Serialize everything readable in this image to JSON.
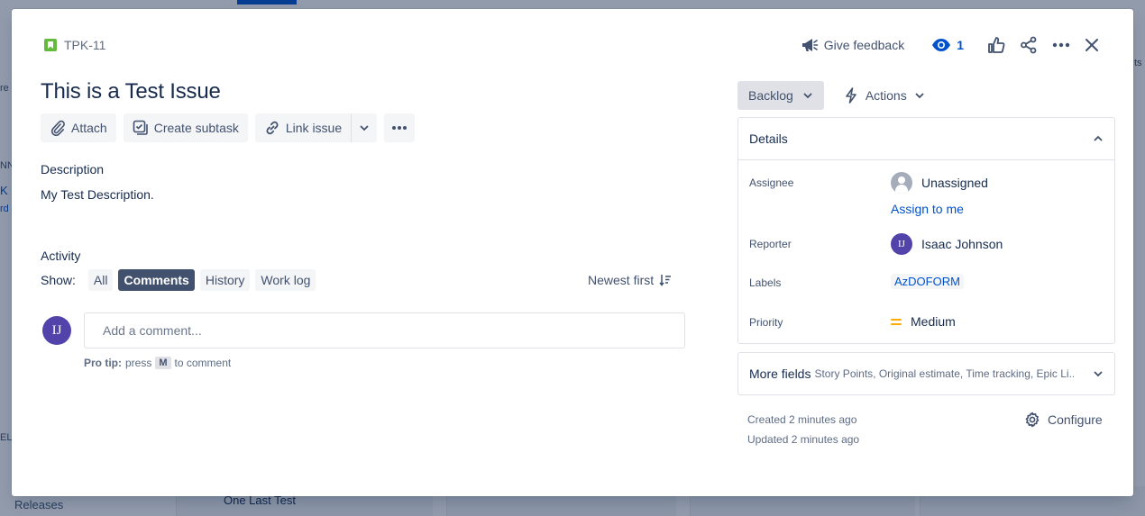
{
  "background": {
    "side_labels": [
      "re",
      "NN",
      "K I",
      "rd",
      "EL"
    ],
    "releases": "Releases",
    "card": "One Last Test",
    "right_edge": "ts"
  },
  "issue": {
    "key": "TPK-11",
    "title": "This is a Test Issue"
  },
  "toolbar": {
    "feedback": "Give feedback",
    "watch_count": "1"
  },
  "actions": {
    "attach": "Attach",
    "create_subtask": "Create subtask",
    "link_issue": "Link issue"
  },
  "description": {
    "label": "Description",
    "text": "My Test Description."
  },
  "activity": {
    "label": "Activity",
    "show_label": "Show:",
    "filters": [
      "All",
      "Comments",
      "History",
      "Work log"
    ],
    "active_filter": "Comments",
    "sort": "Newest first",
    "comment_avatar": "IJ",
    "comment_placeholder": "Add a comment...",
    "protip_bold": "Pro tip:",
    "protip_press": "press",
    "protip_key": "M",
    "protip_rest": "to comment"
  },
  "status": {
    "value": "Backlog",
    "actions": "Actions"
  },
  "details": {
    "title": "Details",
    "assignee_label": "Assignee",
    "assignee_value": "Unassigned",
    "assign_to_me": "Assign to me",
    "reporter_label": "Reporter",
    "reporter_initials": "IJ",
    "reporter_value": "Isaac Johnson",
    "labels_label": "Labels",
    "labels_value": "AzDOFORM",
    "priority_label": "Priority",
    "priority_value": "Medium"
  },
  "more_fields": {
    "title": "More fields",
    "list": "Story Points, Original estimate, Time tracking, Epic Li..."
  },
  "meta": {
    "created": "Created 2 minutes ago",
    "updated": "Updated 2 minutes ago",
    "configure": "Configure"
  },
  "colors": {
    "primary": "#0052cc",
    "avatar": "#5243aa",
    "story": "#63ba3c",
    "priority_medium": "#ffab00"
  }
}
